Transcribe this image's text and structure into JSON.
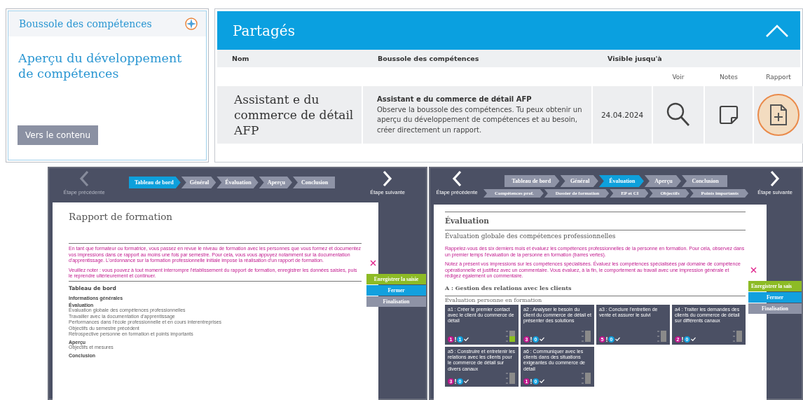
{
  "overview_card": {
    "header": "Boussole des compétences",
    "title": "Aperçu du développement de compétences",
    "button": "Vers le contenu"
  },
  "shared_panel": {
    "title": "Partagés",
    "expanded": true,
    "columns": [
      "Nom",
      "Boussole des compétences",
      "Visible jusqu'à"
    ],
    "action_columns": [
      "Voir",
      "Notes",
      "Rapport"
    ],
    "rows": [
      {
        "name": "Assistant e du commerce de détail AFP",
        "compass_title": "Assistant e du commerce de détail AFP",
        "description": "Observe la boussole des compétences. Tu peux obtenir un aperçu du développement de compétences et au besoin, créer directement un rapport.",
        "visible_until": "24.04.2024",
        "report_highlighted": true
      }
    ]
  },
  "screens": [
    {
      "prev": {
        "label": "Étape précédente",
        "disabled": true
      },
      "next": {
        "label": "Étape suivante",
        "disabled": false
      },
      "steps": [
        {
          "label": "Tableau de bord",
          "selected": true
        },
        {
          "label": "Général",
          "selected": false
        },
        {
          "label": "Évaluation",
          "selected": false
        },
        {
          "label": "Aperçu",
          "selected": false
        },
        {
          "label": "Conclusion",
          "selected": false
        }
      ],
      "blocks": [
        {
          "kind": "title",
          "text": "Rapport de formation",
          "ruled": false
        },
        {
          "kind": "notice",
          "text": "En tant que formateur ou formatrice, vous passez en revue le niveau de formation avec les personnes que vous formez et documentez vos impressions dans ce rapport au moins une fois par semestre. Pour cela, vous vous appuyez notamment sur la documentation d'apprentissage. L'ordonnance sur la formation professionnelle initiale impose la réalisation d'un rapport de formation.",
          "ruled": true
        },
        {
          "kind": "notice",
          "text": "Veuillez noter : vous pouvez à tout moment interrompre l'établissement du rapport de formation, enregistrer les données saisies, puis le reprendre ultérieurement et continuer.",
          "ruled": false
        },
        {
          "kind": "section",
          "text": "Tableau de bord",
          "ruled": true
        },
        {
          "kind": "group",
          "text": "Informations générales",
          "ruled": false
        },
        {
          "kind": "group",
          "text": "Évaluation",
          "ruled": false
        },
        {
          "kind": "item",
          "text": "Évaluation globale des compétences professionnelles",
          "ruled": false
        },
        {
          "kind": "item",
          "text": "Travailler avec la documentation d'apprentissage",
          "ruled": false
        },
        {
          "kind": "item",
          "text": "Performances dans l'école professionnelle et en cours interentreprises",
          "ruled": false
        },
        {
          "kind": "item",
          "text": "Objectifs du semestre précédent",
          "ruled": false
        },
        {
          "kind": "item",
          "text": "Rétrospective personne en formation et points importants",
          "ruled": false
        },
        {
          "kind": "group",
          "text": "Aperçu",
          "ruled": false
        },
        {
          "kind": "item",
          "text": "Objectifs et mesures",
          "ruled": false
        },
        {
          "kind": "group",
          "text": "Conclusion",
          "ruled": false
        }
      ],
      "actions": [
        {
          "label": "Enregistrer la saisie",
          "kind": "save"
        },
        {
          "label": "Fermer",
          "kind": "close"
        },
        {
          "label": "Finalisation",
          "kind": "finish"
        }
      ]
    },
    {
      "prev": {
        "label": "Étape précédente",
        "disabled": false
      },
      "next": {
        "label": "Étape suivante",
        "disabled": false
      },
      "steps": [
        {
          "label": "Tableau de bord",
          "selected": false
        },
        {
          "label": "Général",
          "selected": false
        },
        {
          "label": "Évaluation",
          "selected": true
        },
        {
          "label": "Aperçu",
          "selected": false
        },
        {
          "label": "Conclusion",
          "selected": false
        }
      ],
      "substeps": [
        {
          "label": "Compétences prof.",
          "selected": false
        },
        {
          "label": "Dossier de formation",
          "selected": false
        },
        {
          "label": "EP et CI",
          "selected": false
        },
        {
          "label": "Objectifs",
          "selected": false
        },
        {
          "label": "Points importants",
          "selected": false
        }
      ],
      "blocks": [
        {
          "kind": "title",
          "text": "Évaluation",
          "ruled": true
        },
        {
          "kind": "subtitle",
          "text": "Évaluation globale des compétences professionnelles",
          "ruled": true
        },
        {
          "kind": "notice",
          "text": "Rappelez-vous des six derniers mois et évaluez les compétences professionnelles de la personne en formation. Pour cela, observez dans un premier temps l'évaluation de la personne en formation (barres vertes).",
          "ruled": false
        },
        {
          "kind": "notice",
          "text": "Notez à présent vos impressions sur les compétences spécialisées. Évaluez les compétences spécialisées par domaine de compétence opérationnelle et justifiez avec un commentaire. Vous évaluez, à la fin, le comportement au travail avec une impression générale et rédigez également un commentaire.",
          "ruled": false
        },
        {
          "kind": "domain",
          "text": "A : Gestion des relations avec les clients",
          "ruled": false
        },
        {
          "kind": "caption",
          "text": "Évaluation personne en formation",
          "ruled": true
        },
        {
          "kind": "cards",
          "ruled": false,
          "cards": [
            {
              "text": "a1 : Créer le premier contact avec le client du commerce de détail",
              "open_count": "1",
              "done_count": "1",
              "self_assessed": true
            },
            {
              "text": "a2 : Analyser le besoin du client du commerce de détail et présenter des solutions",
              "open_count": "3",
              "done_count": "0",
              "self_assessed": false
            },
            {
              "text": "a3 : Conclure l'entretien de vente et assurer le suivi",
              "open_count": "5",
              "done_count": "0",
              "self_assessed": false
            },
            {
              "text": "a4 : Traiter les demandes des clients du commerce de détail sur différents canaux",
              "open_count": "2",
              "done_count": "0",
              "self_assessed": false
            },
            {
              "text": "a5 : Construire et entretenir les relations avec les clients pour le commerce de détail sur divers canaux",
              "open_count": "3",
              "done_count": "0",
              "self_assessed": false
            },
            {
              "text": "a6 : Communiquer avec les clients dans des situations exigeantes du commerce de détail",
              "open_count": "1",
              "done_count": "0",
              "self_assessed": false
            }
          ]
        }
      ],
      "actions": [
        {
          "label": "Enregistrer la sais",
          "kind": "save"
        },
        {
          "label": "Fermer",
          "kind": "close"
        },
        {
          "label": "Finalisation",
          "kind": "finish"
        }
      ]
    }
  ]
}
